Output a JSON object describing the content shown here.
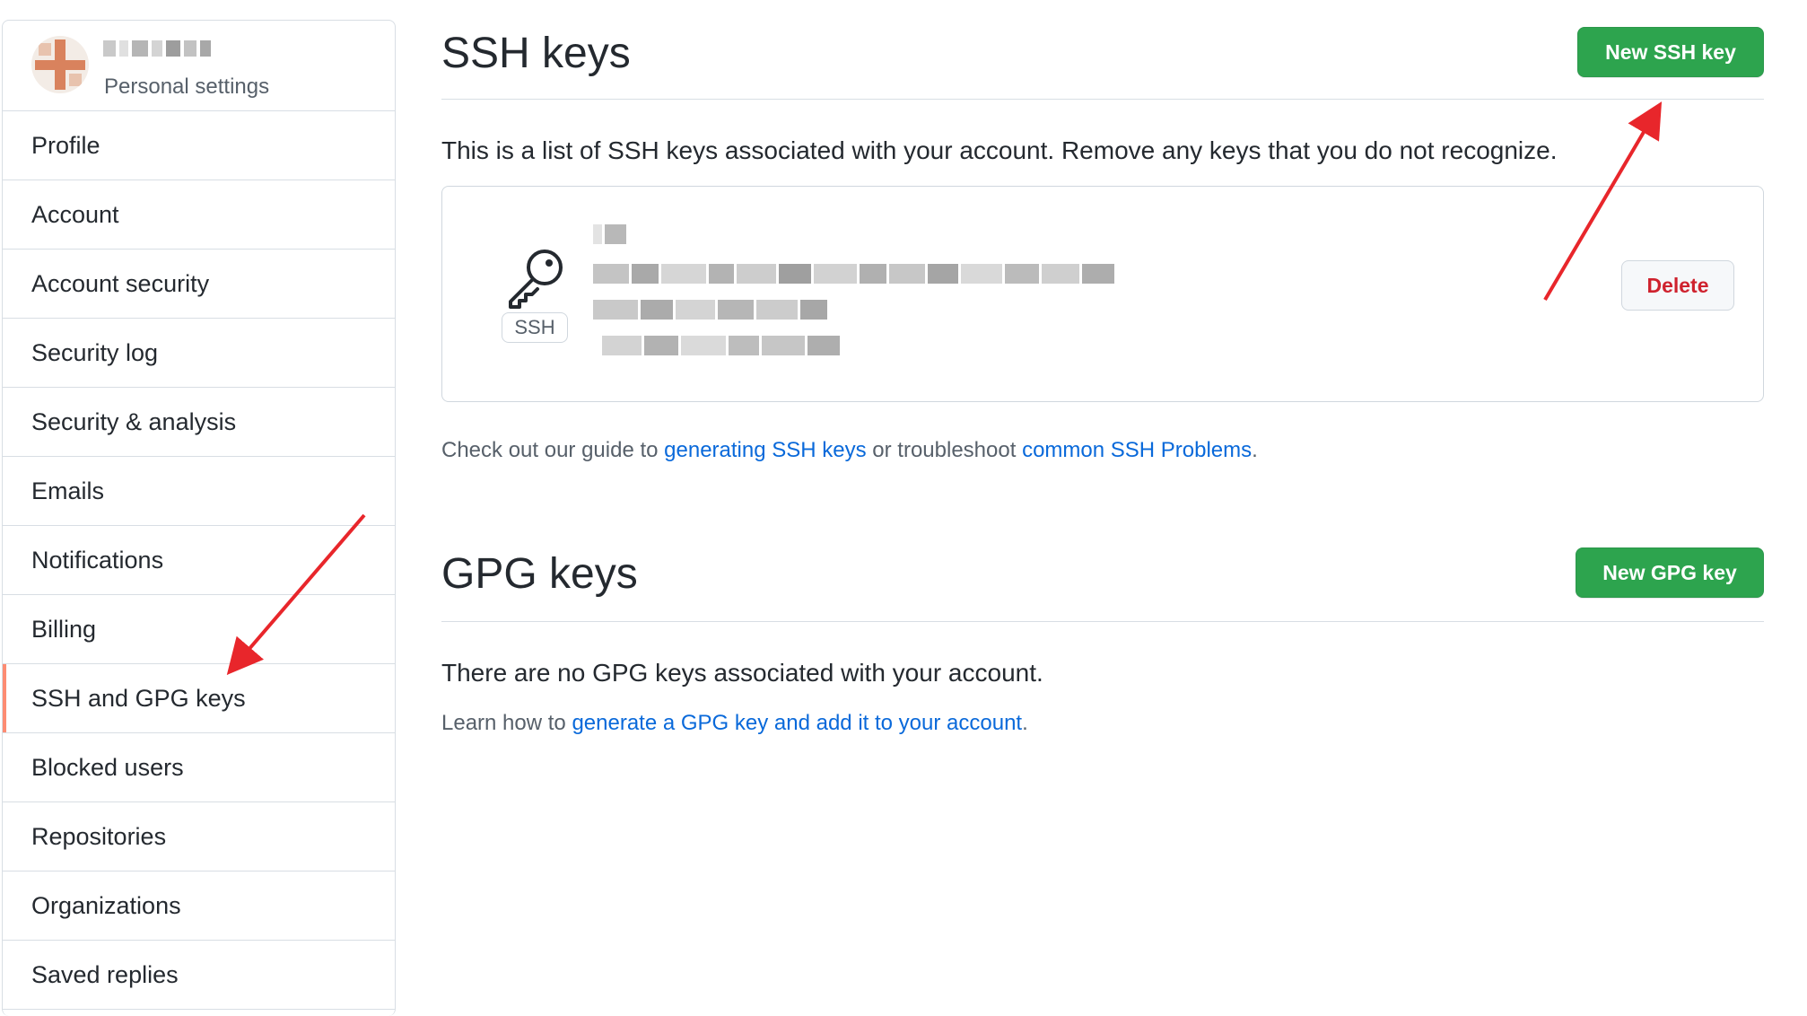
{
  "sidebar": {
    "subtitle": "Personal settings",
    "items": [
      {
        "label": "Profile"
      },
      {
        "label": "Account"
      },
      {
        "label": "Account security"
      },
      {
        "label": "Security log"
      },
      {
        "label": "Security & analysis"
      },
      {
        "label": "Emails"
      },
      {
        "label": "Notifications"
      },
      {
        "label": "Billing"
      },
      {
        "label": "SSH and GPG keys",
        "active": true
      },
      {
        "label": "Blocked users"
      },
      {
        "label": "Repositories"
      },
      {
        "label": "Organizations"
      },
      {
        "label": "Saved replies"
      }
    ]
  },
  "ssh": {
    "title": "SSH keys",
    "new_button": "New SSH key",
    "description": "This is a list of SSH keys associated with your account. Remove any keys that you do not recognize.",
    "key_badge": "SSH",
    "delete_button": "Delete",
    "guide_prefix": "Check out our guide to ",
    "guide_link1": "generating SSH keys",
    "guide_middle": " or troubleshoot ",
    "guide_link2": "common SSH Problems",
    "guide_suffix": "."
  },
  "gpg": {
    "title": "GPG keys",
    "new_button": "New GPG key",
    "empty_text": "There are no GPG keys associated with your account.",
    "learn_prefix": "Learn how to ",
    "learn_link": "generate a GPG key and add it to your account",
    "learn_suffix": "."
  },
  "colors": {
    "primary_green": "#2da44e",
    "link_blue": "#0969da",
    "danger_red": "#cf222e",
    "active_indicator": "#fd8c73",
    "annotation_arrow": "#e8262b"
  },
  "icons": [
    "key-icon",
    "avatar"
  ]
}
